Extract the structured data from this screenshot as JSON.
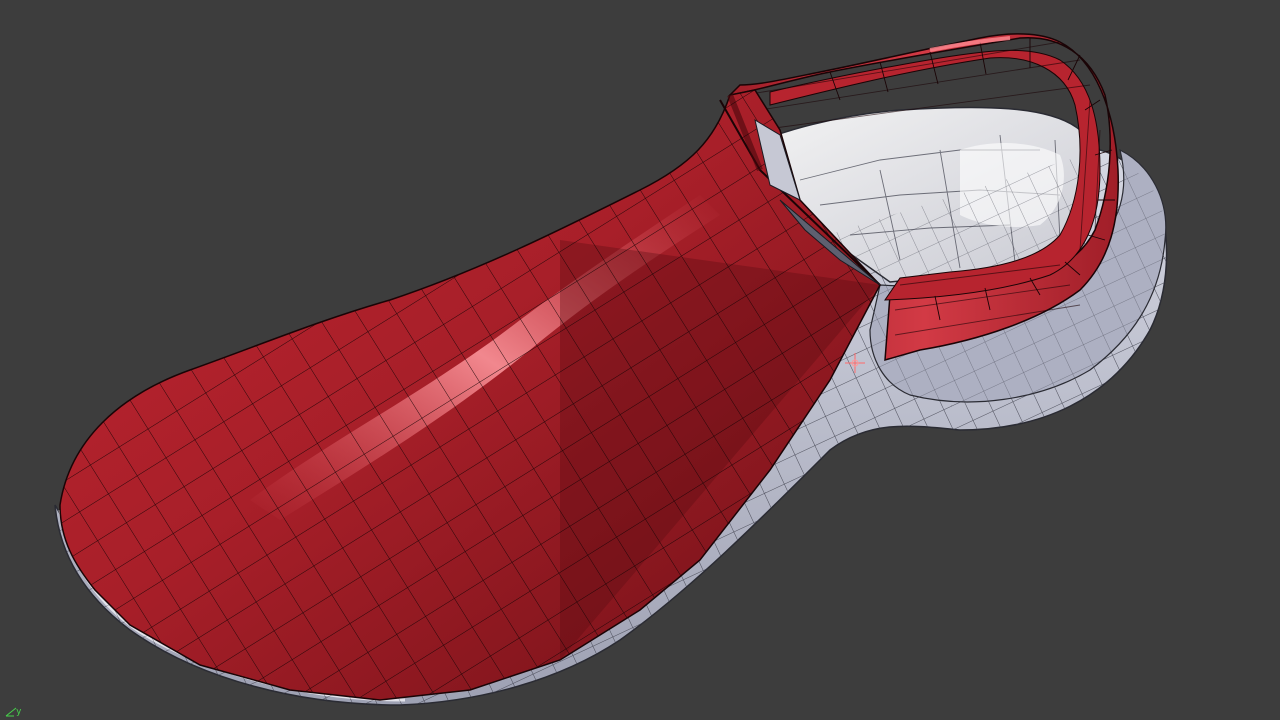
{
  "viewport": {
    "background": "#3d3d3d",
    "model": {
      "name": "shoe-mesh",
      "upper_color": "#9b1b24",
      "upper_highlight": "#f08a90",
      "sole_color": "#b9bccb",
      "insole_color": "#eeeeee",
      "wire_color": "#111111"
    },
    "axis": {
      "label": "y",
      "color": "#46d24a"
    },
    "pivot_icon": "crosshair-icon"
  }
}
